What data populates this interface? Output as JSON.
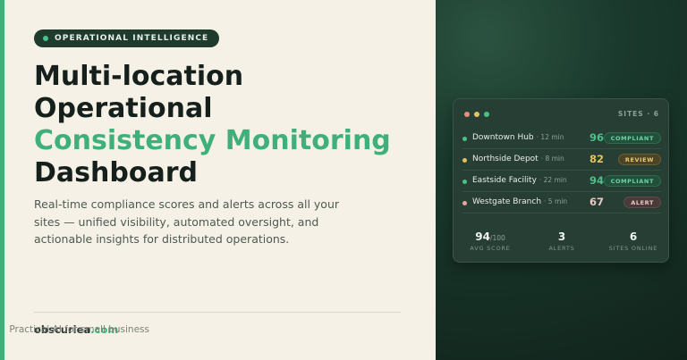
{
  "badge": {
    "label": "OPERATIONAL INTELLIGENCE"
  },
  "headline": {
    "line1": "Multi-location",
    "line2": "Operational",
    "line3": "Consistency Monitoring",
    "line4": "Dashboard"
  },
  "subtext": "Real-time compliance scores and alerts across all your sites — unified visibility, automated oversight, and actionable insights for distributed operations.",
  "footer": {
    "domain_name": "obscuriea",
    "domain_tld": ".com",
    "tagline": "Practical AI for small business"
  },
  "card": {
    "sites_label": "SITES · 6",
    "rows": [
      {
        "name": "Downtown Hub",
        "time": "· 12 min",
        "score": "96",
        "status": "COMPLIANT"
      },
      {
        "name": "Northside Depot",
        "time": "· 8 min",
        "score": "82",
        "status": "REVIEW"
      },
      {
        "name": "Eastside Facility",
        "time": "· 22 min",
        "score": "94",
        "status": "COMPLIANT"
      },
      {
        "name": "Westgate Branch",
        "time": "· 5 min",
        "score": "67",
        "status": "ALERT"
      }
    ],
    "stats": {
      "avg_score": "94",
      "avg_score_max": "/100",
      "avg_score_label": "AVG SCORE",
      "alerts": "3",
      "alerts_label": "ALERTS",
      "sites_online": "6",
      "sites_online_label": "SITES ONLINE"
    }
  },
  "colors": {
    "accent": "#3fb07c",
    "compliant": "#4cc08a",
    "review": "#e2c262",
    "alert": "#e9a79a"
  }
}
